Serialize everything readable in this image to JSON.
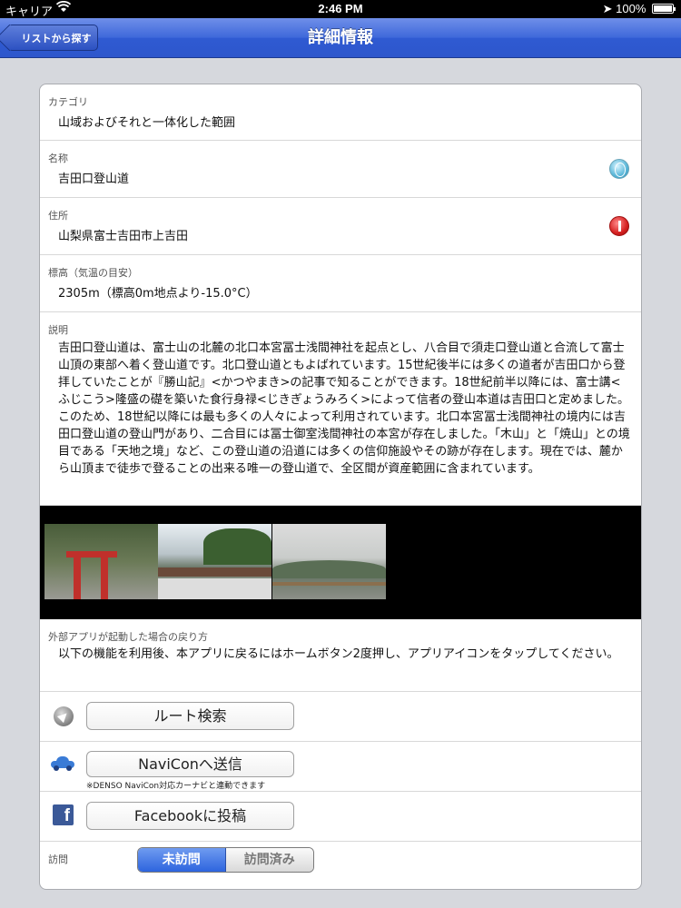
{
  "status_bar": {
    "carrier": "キャリア",
    "time": "2:46 PM",
    "battery": "100%"
  },
  "nav": {
    "back_label": "リストから探す",
    "title": "詳細情報"
  },
  "fields": {
    "category": {
      "label": "カテゴリ",
      "value": "山域およびそれと一体化した範囲"
    },
    "name": {
      "label": "名称",
      "value": "吉田口登山道"
    },
    "address": {
      "label": "住所",
      "value": "山梨県富士吉田市上吉田"
    },
    "altitude": {
      "label": "標高（気温の目安）",
      "value": "2305m（標高0m地点より-15.0°C）"
    },
    "description": {
      "label": "説明",
      "value": "吉田口登山道は、富士山の北麓の北口本宮冨士浅間神社を起点とし、八合目で須走口登山道と合流して富士山頂の東部へ着く登山道です。北口登山道ともよばれています。15世紀後半には多くの道者が吉田口から登拝していたことが『勝山記』<かつやまき>の記事で知ることができます。18世紀前半以降には、富士講<ふじこう>隆盛の礎を築いた食行身禄<じきぎょうみろく>によって信者の登山本道は吉田口と定めました。このため、18世紀以降には最も多くの人々によって利用されています。北口本宮冨士浅間神社の境内には吉田口登山道の登山門があり、二合目には冨士御室浅間神社の本宮が存在しました。「木山」と「焼山」との境目である「天地之境」など、この登山道の沿道には多くの信仰施設やその跡が存在します。現在では、麓から山頂まで徒歩で登ることの出来る唯一の登山道で、全区間が資産範囲に含まれています。"
    }
  },
  "return_info": {
    "label": "外部アプリが起動した場合の戻り方",
    "value": "以下の機能を利用後、本アプリに戻るにはホームボタン2度押し、アプリアイコンをタップしてください。"
  },
  "actions": {
    "route_search": "ルート検索",
    "navicon_send": "NaviConへ送信",
    "navicon_note": "※DENSO NaviCon対応カーナビと連動できます",
    "facebook_post": "Facebookに投稿",
    "facebook_icon_letter": "f"
  },
  "visit": {
    "label": "訪問",
    "options": [
      "未訪問",
      "訪問済み"
    ],
    "selected": "未訪問"
  },
  "colors": {
    "nav_blue": "#3e68da",
    "segment_selected": "#2d64de",
    "facebook": "#3b5998",
    "pin_red": "#d62020"
  }
}
